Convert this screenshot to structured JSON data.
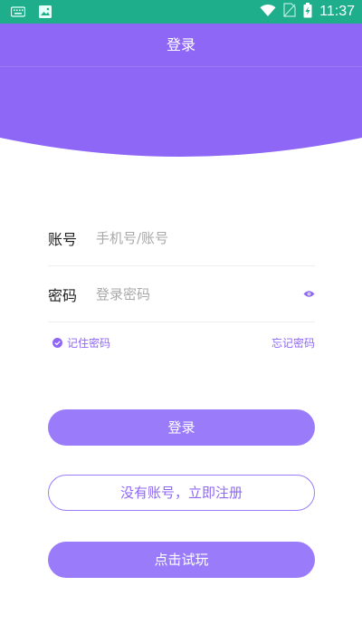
{
  "status_bar": {
    "time": "11:37",
    "icons": [
      "keyboard-icon",
      "image-icon",
      "wifi-icon",
      "no-sim-icon",
      "battery-charging-icon"
    ],
    "background": "#1fae8b"
  },
  "header": {
    "title": "登录",
    "background": "#8e67f6"
  },
  "form": {
    "account_label": "账号",
    "account_placeholder": "手机号/账号",
    "password_label": "密码",
    "password_placeholder": "登录密码"
  },
  "options": {
    "remember_label": "记住密码",
    "forgot_label": "忘记密码"
  },
  "buttons": {
    "login": "登录",
    "register": "没有账号，立即注册",
    "trial": "点击试玩"
  },
  "colors": {
    "accent": "#8e67f6",
    "button": "#9a7cfa"
  }
}
